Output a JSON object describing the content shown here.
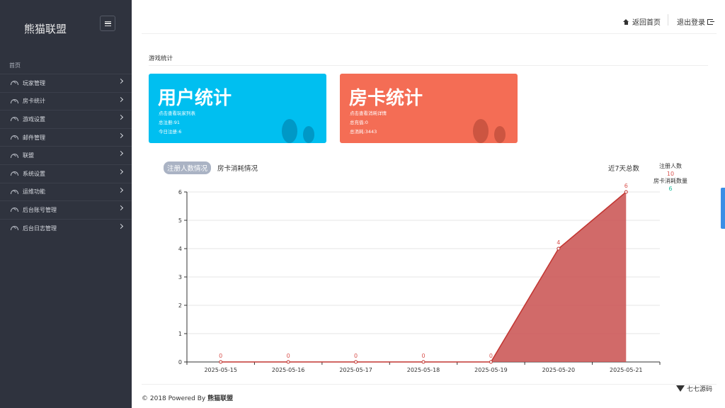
{
  "sidebar": {
    "brand": "熊猫联盟",
    "home_label": "首页",
    "items": [
      {
        "label": "玩家管理"
      },
      {
        "label": "房卡统计"
      },
      {
        "label": "游戏设置"
      },
      {
        "label": "邮件管理"
      },
      {
        "label": "联盟"
      },
      {
        "label": "系统设置"
      },
      {
        "label": "运维功能"
      },
      {
        "label": "后台账号管理"
      },
      {
        "label": "后台日志管理"
      }
    ]
  },
  "header": {
    "home_link": "返回首页",
    "logout_link": "退出登录"
  },
  "main": {
    "section_title": "游戏统计",
    "cards": {
      "user": {
        "title": "用户统计",
        "link": "点击查看玩家列表",
        "total": "总注册:91",
        "today": "今日注册:6"
      },
      "room": {
        "title": "房卡统计",
        "link": "点击查看消耗详情",
        "recharge": "总充值:0",
        "consume": "总消耗:3443"
      }
    },
    "tabs": [
      {
        "label": "注册人数情况",
        "active": true
      },
      {
        "label": "房卡消耗情况",
        "active": false
      }
    ],
    "week_label": "近7天总数",
    "stats": {
      "reg_label": "注册人数",
      "reg_value": "10",
      "room_label": "房卡消耗数量",
      "room_value": "6"
    }
  },
  "chart_data": {
    "type": "area",
    "categories": [
      "2025-05-15",
      "2025-05-16",
      "2025-05-17",
      "2025-05-18",
      "2025-05-19",
      "2025-05-20",
      "2025-05-21"
    ],
    "values": [
      0,
      0,
      0,
      0,
      0,
      4,
      6
    ],
    "ylim": [
      0,
      6
    ],
    "yticks": [
      0,
      1,
      2,
      3,
      4,
      5,
      6
    ],
    "grid": true,
    "colors": {
      "fill": "#c9504f",
      "line": "#c23531",
      "label": "#d9534f"
    }
  },
  "footer": {
    "copyright_prefix": "© 2018 Powered By ",
    "copyright_brand": "熊猫联盟",
    "watermark": "七七源码"
  },
  "colors": {
    "sidebar_bg": "#2f333e",
    "user_card": "#00bff0",
    "room_card": "#f46d55",
    "reg_value": "#d9534f",
    "room_value": "#1abc9c"
  }
}
